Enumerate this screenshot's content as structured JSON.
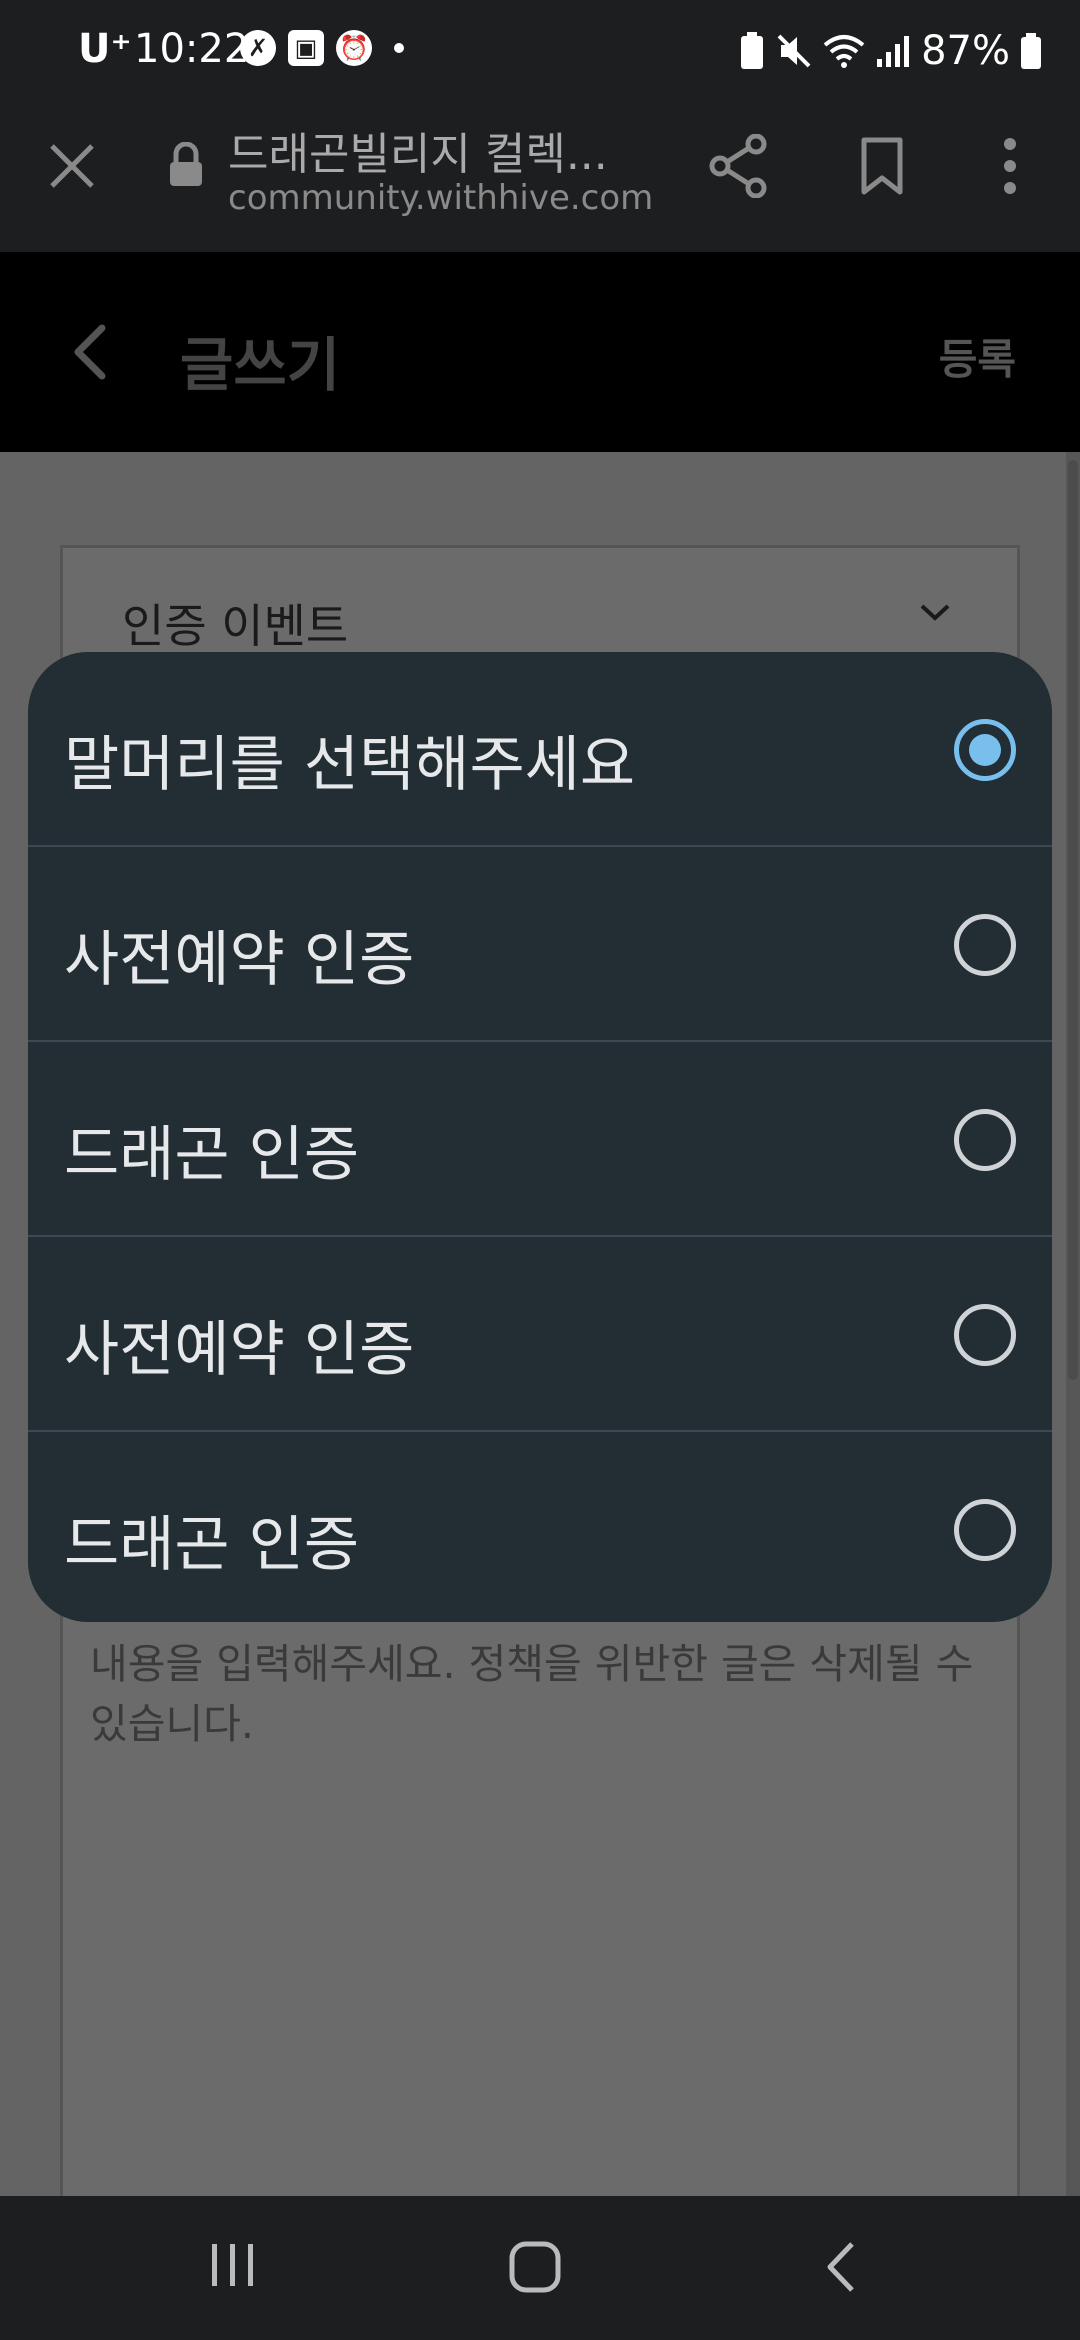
{
  "status_bar": {
    "carrier": "U⁺",
    "time": "10:22",
    "battery": "87%"
  },
  "browser": {
    "title": "드래곤빌리지 컬렉...",
    "url": "community.withhive.com"
  },
  "header": {
    "title": "글쓰기",
    "register_label": "등록"
  },
  "form": {
    "category_value": "인증 이벤트",
    "content_placeholder": "내용을 입력해주세요. 정책을 위반한 글은 삭제될 수 있습니다."
  },
  "dialog": {
    "options": [
      {
        "label": "말머리를 선택해주세요",
        "selected": true
      },
      {
        "label": "사전예약 인증",
        "selected": false
      },
      {
        "label": "드래곤 인증",
        "selected": false
      },
      {
        "label": "사전예약 인증",
        "selected": false
      },
      {
        "label": "드래곤 인증",
        "selected": false
      }
    ]
  },
  "colors": {
    "dialog_bg": "#222d34",
    "radio_selected": "#78bfee"
  }
}
